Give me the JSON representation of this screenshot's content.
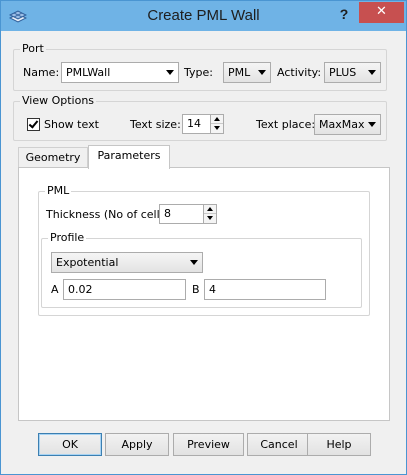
{
  "window": {
    "title": "Create PML Wall",
    "help_label": "?",
    "close_label": "✕"
  },
  "port": {
    "group_label": "Port",
    "name_label": "Name:",
    "name_value": "PMLWall",
    "type_label": "Type:",
    "type_value": "PML",
    "activity_label": "Activity:",
    "activity_value": "PLUS"
  },
  "view_options": {
    "group_label": "View Options",
    "show_text_label": "Show text",
    "show_text_checked": true,
    "text_size_label": "Text size:",
    "text_size_value": "14",
    "text_place_label": "Text place:",
    "text_place_value": "MaxMax"
  },
  "tabs": [
    {
      "label": "Geometry",
      "active": false
    },
    {
      "label": "Parameters",
      "active": true
    }
  ],
  "pml": {
    "group_label": "PML",
    "thickness_label": "Thickness (No of cells)",
    "thickness_value": "8",
    "profile": {
      "group_label": "Profile",
      "type_value": "Expotential",
      "a_label": "A",
      "a_value": "0.02",
      "b_label": "B",
      "b_value": "4"
    }
  },
  "buttons": {
    "ok": "OK",
    "apply": "Apply",
    "preview": "Preview",
    "cancel": "Cancel",
    "help": "Help"
  },
  "colors": {
    "titlebar": "#6fb3e6",
    "close_button": "#c75050",
    "dialog_bg": "#f0f0f0"
  }
}
